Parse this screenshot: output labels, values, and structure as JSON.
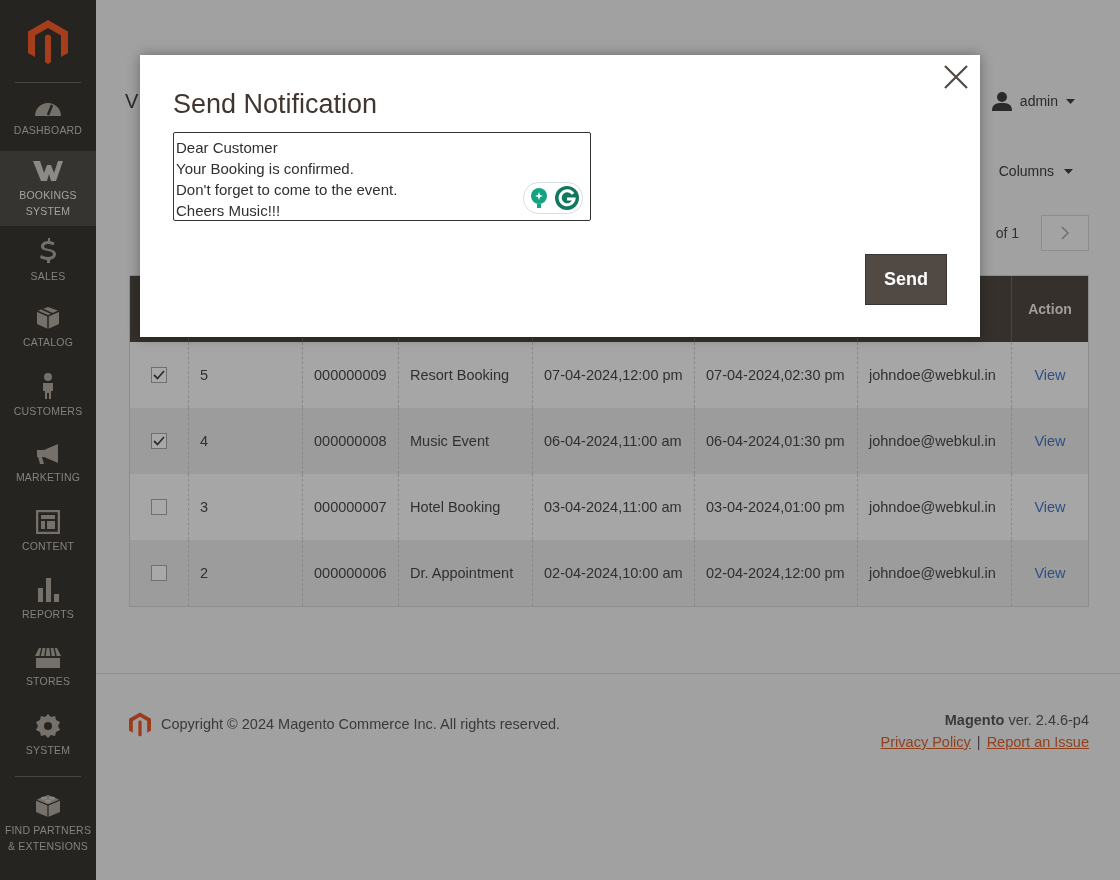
{
  "sidebar": {
    "items": [
      {
        "label": "DASHBOARD",
        "selected": false
      },
      {
        "label": "BOOKINGS SYSTEM",
        "selected": true
      },
      {
        "label": "SALES",
        "selected": false
      },
      {
        "label": "CATALOG",
        "selected": false
      },
      {
        "label": "CUSTOMERS",
        "selected": false
      },
      {
        "label": "MARKETING",
        "selected": false
      },
      {
        "label": "CONTENT",
        "selected": false
      },
      {
        "label": "REPORTS",
        "selected": false
      },
      {
        "label": "STORES",
        "selected": false
      },
      {
        "label": "SYSTEM",
        "selected": false
      },
      {
        "label": "FIND PARTNERS & EXTENSIONS",
        "selected": false
      }
    ]
  },
  "header": {
    "page_title": "V",
    "user": "admin"
  },
  "toolbar": {
    "columns_button": "Columns",
    "pager_total": "of 1"
  },
  "table": {
    "columns": [
      {
        "label": "Action"
      }
    ],
    "rows": [
      {
        "checked": true,
        "column_2": "5",
        "column_3": "000000009",
        "column_4": "Resort Booking",
        "column_5": "07-04-2024,12:00 pm",
        "column_6": "07-04-2024,02:30 pm",
        "column_7": "johndoe@webkul.in",
        "action": "View"
      },
      {
        "checked": true,
        "column_2": "4",
        "column_3": "000000008",
        "column_4": "Music Event",
        "column_5": "06-04-2024,11:00 am",
        "column_6": "06-04-2024,01:30 pm",
        "column_7": "johndoe@webkul.in",
        "action": "View"
      },
      {
        "checked": false,
        "column_2": "3",
        "column_3": "000000007",
        "column_4": "Hotel Booking",
        "column_5": "03-04-2024,11:00 am",
        "column_6": "03-04-2024,01:00 pm",
        "column_7": "johndoe@webkul.in",
        "action": "View"
      },
      {
        "checked": false,
        "column_2": "2",
        "column_3": "000000006",
        "column_4": "Dr. Appointment",
        "column_5": "02-04-2024,10:00 am",
        "column_6": "02-04-2024,12:00 pm",
        "column_7": "johndoe@webkul.in",
        "action": "View"
      }
    ]
  },
  "modal": {
    "title": "Send Notification",
    "message": {
      "value": "Dear Customer\nYour Booking is confirmed.\nDon't forget to come to the event.\nCheers Music!!!"
    },
    "send_button": "Send"
  },
  "footer": {
    "copyright": "Copyright © 2024 Magento Commerce Inc. All rights reserved.",
    "brand": "Magento",
    "version": "ver. 2.4.6-p4",
    "links": [
      "Privacy Policy",
      "Report an Issue"
    ],
    "separator": "|"
  }
}
